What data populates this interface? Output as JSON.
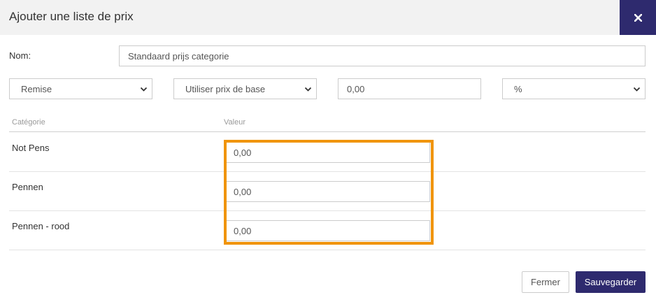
{
  "modal": {
    "title": "Ajouter une liste de prix",
    "close_icon": "close-icon"
  },
  "form": {
    "nom_label": "Nom:",
    "nom_value": "Standaard prijs categorie",
    "type_select": "Remise",
    "base_select": "Utiliser prix de base",
    "amount_value": "0,00",
    "unit_select": "%"
  },
  "table": {
    "headers": [
      "Catégorie",
      "Valeur"
    ],
    "rows": [
      {
        "category": "Not Pens",
        "value": "0,00"
      },
      {
        "category": "Pennen",
        "value": "0,00"
      },
      {
        "category": "Pennen - rood",
        "value": "0,00"
      }
    ]
  },
  "footer": {
    "close_label": "Fermer",
    "save_label": "Sauvegarder"
  },
  "colors": {
    "accent": "#2e2a6e",
    "highlight": "#f0940a"
  }
}
